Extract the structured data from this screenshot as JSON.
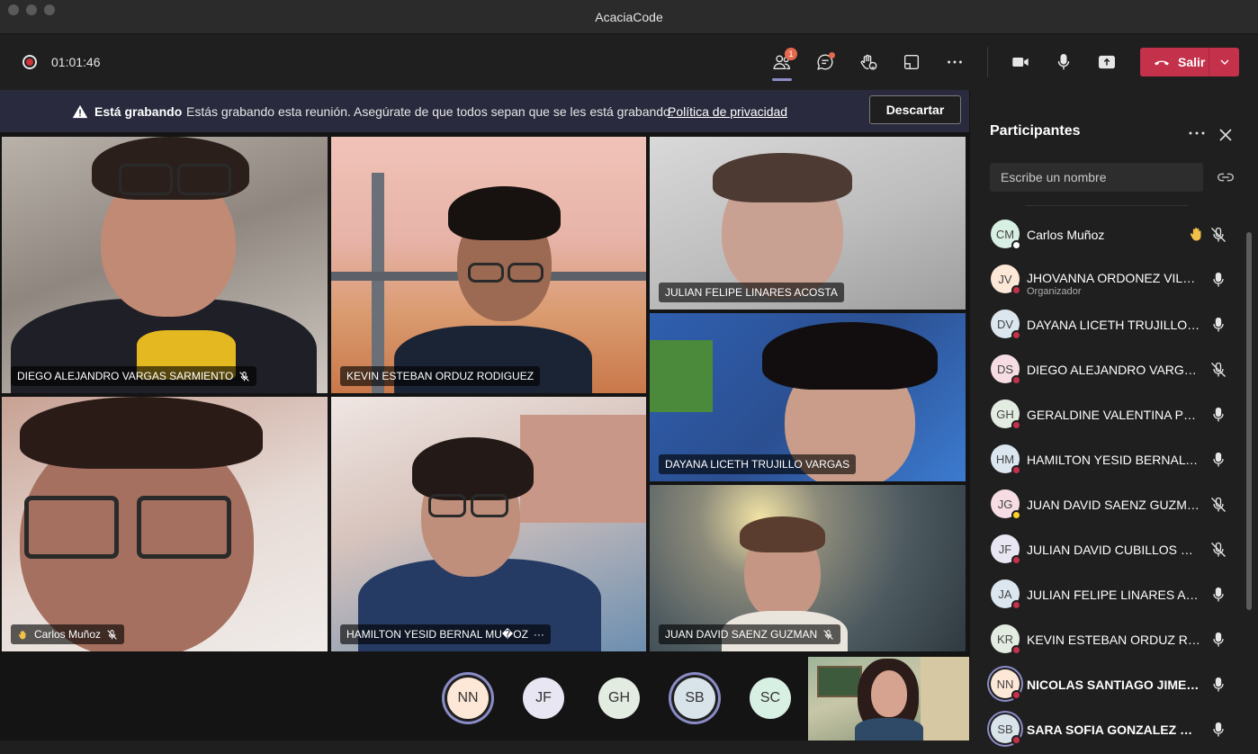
{
  "window": {
    "title": "AcaciaCode"
  },
  "toolbar": {
    "timer": "01:01:46",
    "participants_badge": "1",
    "leave_label": "Salir"
  },
  "banner": {
    "title": "Está grabando",
    "message": "Estás grabando esta reunión. Asegúrate de que todos sepan que se les está grabando.",
    "link": "Política de privacidad",
    "dismiss": "Descartar"
  },
  "videos": [
    {
      "name": "DIEGO ALEJANDRO VARGAS SARMIENTO",
      "muted": true
    },
    {
      "name": "KEVIN ESTEBAN ORDUZ RODIGUEZ",
      "muted": false
    },
    {
      "name": "JULIAN FELIPE LINARES ACOSTA",
      "muted": false
    },
    {
      "name": "DAYANA LICETH TRUJILLO VARGAS",
      "muted": false
    },
    {
      "name": "Carlos Muñoz",
      "muted": true,
      "hand_raised": true
    },
    {
      "name": "HAMILTON YESID BERNAL MU�OZ",
      "muted": false,
      "more": "···"
    },
    {
      "name": "JUAN DAVID SAENZ GUZMAN",
      "muted": true
    }
  ],
  "bottom_avatars": [
    {
      "initials": "NN",
      "color": "#fde7d6",
      "ring": true
    },
    {
      "initials": "JF",
      "color": "#e9e6f3",
      "ring": false
    },
    {
      "initials": "GH",
      "color": "#e3ece1",
      "ring": false
    },
    {
      "initials": "SB",
      "color": "#d9e3ea",
      "ring": true
    },
    {
      "initials": "SC",
      "color": "#d8efe4",
      "ring": false
    }
  ],
  "panel": {
    "title": "Participantes",
    "search_placeholder": "Escribe un nombre",
    "participants": [
      {
        "initials": "CM",
        "name": "Carlos Muñoz",
        "avatar_color": "#d8efe4",
        "status": "white",
        "mic": "muted",
        "hand": true
      },
      {
        "initials": "JV",
        "name": "JHOVANNA ORDONEZ VILLE...",
        "role": "Organizador",
        "avatar_color": "#fde7d6",
        "status": "red",
        "mic": "on"
      },
      {
        "initials": "DV",
        "name": "DAYANA LICETH TRUJILLO V...",
        "avatar_color": "#dbe6ef",
        "status": "red",
        "mic": "on"
      },
      {
        "initials": "DS",
        "name": "DIEGO ALEJANDRO VARGAS ...",
        "avatar_color": "#f6dde4",
        "status": "red",
        "mic": "muted"
      },
      {
        "initials": "GH",
        "name": "GERALDINE VALENTINA PE�...",
        "avatar_color": "#e3ece1",
        "status": "red",
        "mic": "on"
      },
      {
        "initials": "HM",
        "name": "HAMILTON YESID BERNAL M...",
        "avatar_color": "#dbe6ef",
        "status": "red",
        "mic": "on"
      },
      {
        "initials": "JG",
        "name": "JUAN DAVID SAENZ GUZMAN",
        "avatar_color": "#f6dde4",
        "status": "yellow",
        "mic": "muted"
      },
      {
        "initials": "JF",
        "name": "JULIAN DAVID CUBILLOS FO...",
        "avatar_color": "#e9e6f3",
        "status": "red",
        "mic": "muted"
      },
      {
        "initials": "JA",
        "name": "JULIAN FELIPE LINARES ACOS...",
        "avatar_color": "#dbe6ef",
        "status": "red",
        "mic": "on"
      },
      {
        "initials": "KR",
        "name": "KEVIN ESTEBAN ORDUZ ROD...",
        "avatar_color": "#e3ece1",
        "status": "red",
        "mic": "on"
      },
      {
        "initials": "NN",
        "name": "NICOLAS SANTIAGO JIMENE...",
        "avatar_color": "#fde7d6",
        "status": "red",
        "mic": "on",
        "bold": true,
        "ring": true
      },
      {
        "initials": "SB",
        "name": "SARA SOFIA GONZALEZ BAR...",
        "avatar_color": "#d9e3ea",
        "status": "red",
        "mic": "on",
        "bold": true,
        "ring": true
      }
    ]
  }
}
